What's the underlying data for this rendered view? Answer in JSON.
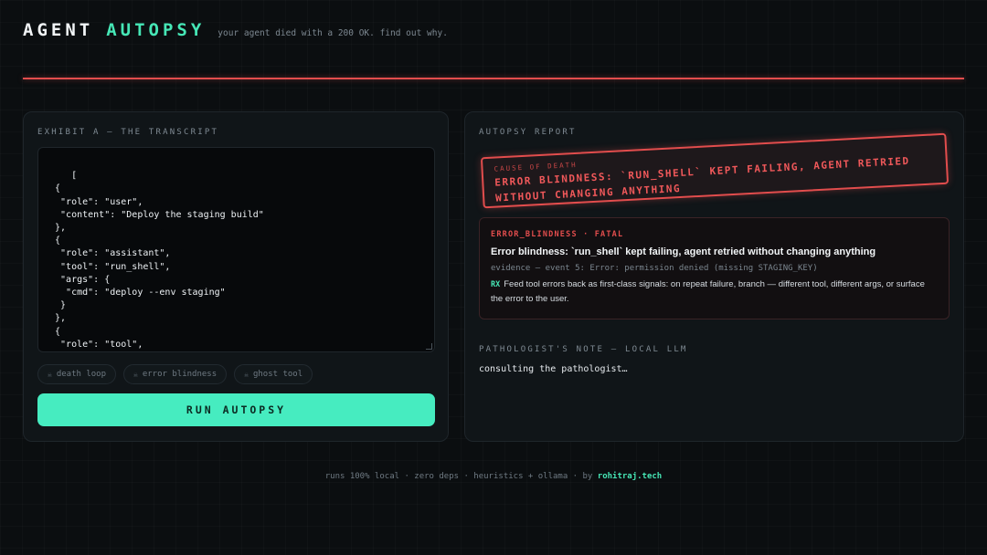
{
  "header": {
    "logo_part1": "AGENT",
    "logo_part2": "AUTOPSY",
    "tagline": "your agent died with a 200 OK. find out why."
  },
  "left_panel": {
    "title": "EXHIBIT A — THE TRANSCRIPT",
    "transcript": "[\n {\n  \"role\": \"user\",\n  \"content\": \"Deploy the staging build\"\n },\n {\n  \"role\": \"assistant\",\n  \"tool\": \"run_shell\",\n  \"args\": {\n   \"cmd\": \"deploy --env staging\"\n  }\n },\n {\n  \"role\": \"tool\",\n  \"content\": \"Error: permission denied (missing STAGING_KEY)\"\n },",
    "chips": [
      {
        "icon": "skull-icon",
        "glyph": "☠",
        "label": "death loop"
      },
      {
        "icon": "skull-icon",
        "glyph": "☠",
        "label": "error blindness"
      },
      {
        "icon": "skull-icon",
        "glyph": "☠",
        "label": "ghost tool"
      }
    ],
    "run_button": "RUN AUTOPSY"
  },
  "right_panel": {
    "title": "AUTOPSY REPORT",
    "stamp": {
      "label": "CAUSE OF DEATH",
      "text": "ERROR BLINDNESS: `RUN_SHELL` KEPT FAILING, AGENT RETRIED WITHOUT CHANGING ANYTHING"
    },
    "finding": {
      "code": "ERROR_BLINDNESS · FATAL",
      "title": "Error blindness: `run_shell` kept failing, agent retried without changing anything",
      "evidence": "evidence — event 5: Error: permission denied (missing STAGING_KEY)",
      "rx_label": "RX",
      "rx_text": "Feed tool errors back as first-class signals: on repeat failure, branch — different tool, different args, or surface the error to the user."
    },
    "note_title": "PATHOLOGIST'S NOTE — LOCAL LLM",
    "note_text": "consulting the pathologist…"
  },
  "footer": {
    "text": "runs 100% local · zero deps · heuristics + ollama · by",
    "link": "rohitraj.tech"
  },
  "colors": {
    "accent": "#46e7b6",
    "danger": "#e24d4d",
    "background": "#0b0e10"
  }
}
